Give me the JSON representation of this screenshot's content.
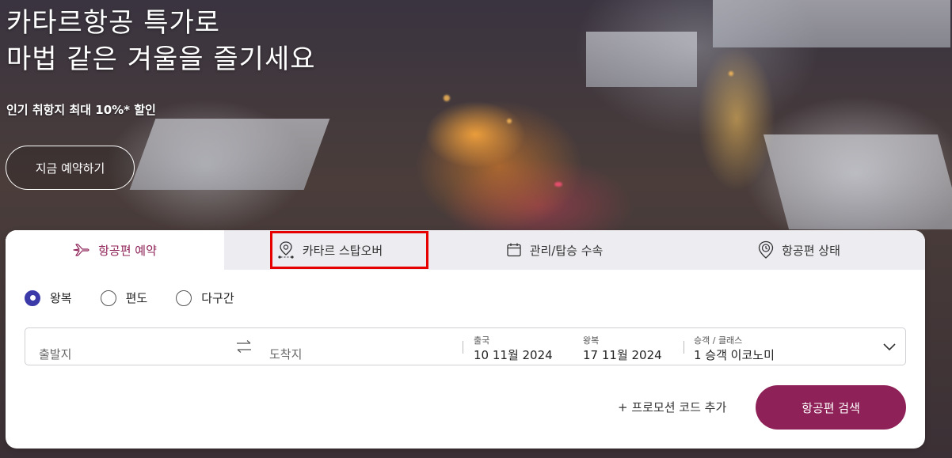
{
  "hero": {
    "title_line1": "카타르항공 특가로",
    "title_line2": "마법 같은 겨울을 즐기세요",
    "subtitle": "인기 취항지 최대 10%* 할인",
    "cta_label": "지금 예약하기"
  },
  "tabs": [
    {
      "label": "항공편 예약",
      "icon": "airplane-icon"
    },
    {
      "label": "카타르 스탑오버",
      "icon": "stopover-pin-icon"
    },
    {
      "label": "관리/탑승 수속",
      "icon": "calendar-icon"
    },
    {
      "label": "항공편 상태",
      "icon": "clock-pin-icon"
    }
  ],
  "trip_types": [
    {
      "label": "왕복",
      "selected": true
    },
    {
      "label": "편도",
      "selected": false
    },
    {
      "label": "다구간",
      "selected": false
    }
  ],
  "search": {
    "from_placeholder": "출발지",
    "to_placeholder": "도착지",
    "depart_label": "출국",
    "depart_value": "10 11월 2024",
    "return_label": "왕복",
    "return_value": "17 11월 2024",
    "pax_label": "승객 / 클래스",
    "pax_value": "1 승객 이코노미"
  },
  "promo_label": "+ 프로모션 코드 추가",
  "search_button_label": "항공편 검색",
  "colors": {
    "brand": "#8e2157",
    "radio_selected": "#3b3aa8",
    "highlight_outline": "#e60000"
  }
}
